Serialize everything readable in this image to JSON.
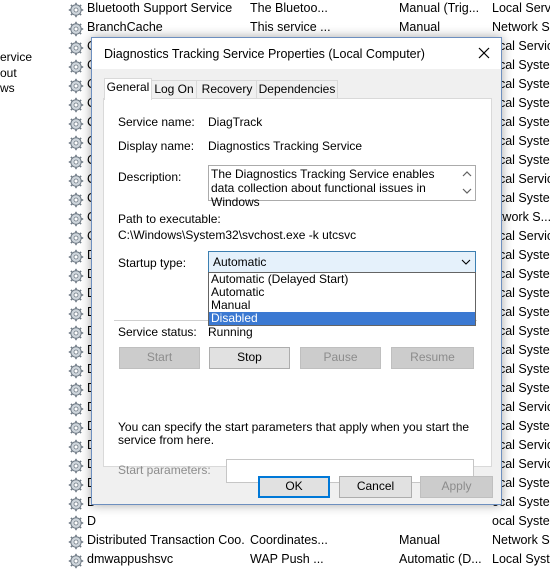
{
  "left_panel": {
    "lines": [
      "ervice",
      "out",
      "ws"
    ]
  },
  "services": [
    {
      "name": "Bluetooth Support Service",
      "description": "The Bluetoo...",
      "startup": "Manual (Trig...",
      "logon": "Local Servic"
    },
    {
      "name": "BranchCache",
      "description": "This service ...",
      "startup": "Manual",
      "logon": "Network S..."
    },
    {
      "name": "C",
      "description": "",
      "startup": "",
      "logon": "ocal Servic"
    },
    {
      "name": "C",
      "description": "",
      "startup": "",
      "logon": "ocal Syste"
    },
    {
      "name": "C",
      "description": "",
      "startup": "",
      "logon": "ocal Syste"
    },
    {
      "name": "C",
      "description": "",
      "startup": "",
      "logon": "ocal Syste"
    },
    {
      "name": "C",
      "description": "",
      "startup": "",
      "logon": "ocal Syste"
    },
    {
      "name": "C",
      "description": "",
      "startup": "",
      "logon": "ocal Syste"
    },
    {
      "name": "C",
      "description": "",
      "startup": "",
      "logon": "ocal Syste"
    },
    {
      "name": "C",
      "description": "",
      "startup": "",
      "logon": "ocal Servic"
    },
    {
      "name": "C",
      "description": "",
      "startup": "",
      "logon": "ocal Syste"
    },
    {
      "name": "C",
      "description": "",
      "startup": "",
      "logon": "etwork S..."
    },
    {
      "name": "C",
      "description": "",
      "startup": "",
      "logon": "ocal Servic"
    },
    {
      "name": "D",
      "description": "",
      "startup": "",
      "logon": "ocal Syste"
    },
    {
      "name": "D",
      "description": "",
      "startup": "",
      "logon": "ocal Syste"
    },
    {
      "name": "D",
      "description": "",
      "startup": "",
      "logon": "ocal Syste"
    },
    {
      "name": "D",
      "description": "",
      "startup": "",
      "logon": "ocal Syste"
    },
    {
      "name": "D",
      "description": "",
      "startup": "",
      "logon": "ocal Syste"
    },
    {
      "name": "D",
      "description": "",
      "startup": "",
      "logon": "ocal Syste"
    },
    {
      "name": "D",
      "description": "",
      "startup": "",
      "logon": "ocal Syste"
    },
    {
      "name": "D",
      "description": "",
      "startup": "",
      "logon": "ocal Syste"
    },
    {
      "name": "D",
      "description": "",
      "startup": "",
      "logon": "ocal Servic"
    },
    {
      "name": "D",
      "description": "",
      "startup": "",
      "logon": "ocal Syste"
    },
    {
      "name": "D",
      "description": "",
      "startup": "",
      "logon": "ocal Servic"
    },
    {
      "name": "D",
      "description": "",
      "startup": "",
      "logon": "ocal Servic"
    },
    {
      "name": "D",
      "description": "",
      "startup": "",
      "logon": "ocal Syste"
    },
    {
      "name": "D",
      "description": "",
      "startup": "",
      "logon": "ocal Syste"
    },
    {
      "name": "D",
      "description": "",
      "startup": "",
      "logon": "ocal Syste"
    },
    {
      "name": "Distributed Transaction Coo...",
      "description": "Coordinates...",
      "startup": "Manual",
      "logon": "Network S..."
    },
    {
      "name": "dmwappushsvc",
      "description": "WAP Push ...",
      "startup": "Automatic (D...",
      "logon": "Local Syste"
    }
  ],
  "dialog": {
    "title": "Diagnostics Tracking Service Properties (Local Computer)",
    "tabs": [
      "General",
      "Log On",
      "Recovery",
      "Dependencies"
    ],
    "active_tab": "General",
    "service_name_label": "Service name:",
    "service_name": "DiagTrack",
    "display_name_label": "Display name:",
    "display_name": "Diagnostics Tracking Service",
    "description_label": "Description:",
    "description": "The Diagnostics Tracking Service enables data collection about functional issues in Windows",
    "path_label": "Path to executable:",
    "path": "C:\\Windows\\System32\\svchost.exe -k utcsvc",
    "startup_type_label": "Startup type:",
    "startup_type_value": "Automatic",
    "startup_options": [
      "Automatic (Delayed Start)",
      "Automatic",
      "Manual",
      "Disabled"
    ],
    "highlighted_option": "Disabled",
    "service_status_label": "Service status:",
    "service_status": "Running",
    "buttons": {
      "start": "Start",
      "stop": "Stop",
      "pause": "Pause",
      "resume": "Resume"
    },
    "help_text": "You can specify the start parameters that apply when you start the service from here.",
    "start_params_label": "Start parameters:",
    "start_params_value": "",
    "footer": {
      "ok": "OK",
      "cancel": "Cancel",
      "apply": "Apply"
    }
  },
  "colors": {
    "selection": "#3b79d2",
    "combo_bg": "#e5f1fb",
    "dialog_border": "#6d8fbf"
  }
}
